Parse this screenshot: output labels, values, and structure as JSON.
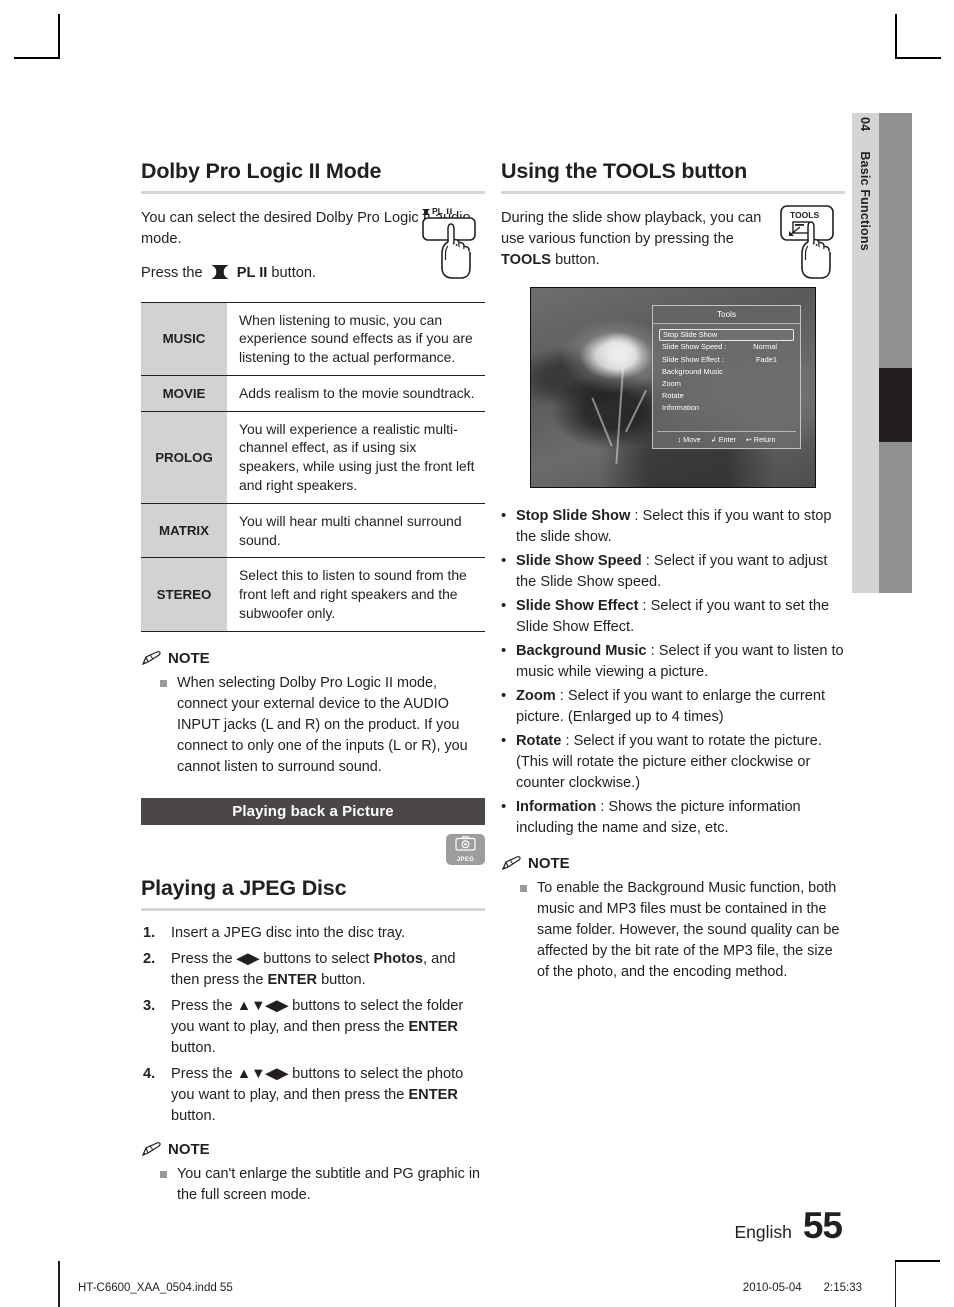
{
  "page": {
    "chapter_number": "04",
    "chapter_title": "Basic Functions",
    "language": "English",
    "page_number": "55",
    "footer_file": "HT-C6600_XAA_0504.indd   55",
    "footer_date": "2010-05-04",
    "footer_time": "2:15:33"
  },
  "left_column": {
    "heading": "Dolby Pro Logic II Mode",
    "intro_line1": "You can select the desired Dolby Pro",
    "intro_line2": "Logic II audio mode.",
    "press_prefix": "Press the",
    "press_button": "PL II",
    "press_suffix": "button.",
    "button_illustration_label": "PL II",
    "modes_table": {
      "rows": [
        {
          "name": "MUSIC",
          "desc": "When listening to music, you can experience sound effects as if you are listening to the actual performance."
        },
        {
          "name": "MOVIE",
          "desc": "Adds realism to the movie soundtrack."
        },
        {
          "name": "PROLOG",
          "desc": "You will experience a realistic multi-channel effect, as if using six speakers, while using just the front left and right speakers."
        },
        {
          "name": "MATRIX",
          "desc": "You will hear multi channel surround sound."
        },
        {
          "name": "STEREO",
          "desc": "Select this to listen to sound from the front left and right speakers and the subwoofer only."
        }
      ]
    },
    "note_label": "NOTE",
    "note_items": [
      "When selecting Dolby Pro Logic II mode, connect your external device to the AUDIO INPUT jacks (L and R) on the product. If you connect to only one of the inputs (L or R), you cannot listen to surround sound."
    ],
    "section_bar": "Playing back a Picture",
    "media_badge": "JPEG",
    "subheading": "Playing a JPEG Disc",
    "steps": [
      {
        "parts": [
          {
            "t": "Insert a JPEG disc into the disc tray.",
            "b": false
          }
        ]
      },
      {
        "parts": [
          {
            "t": "Press the ",
            "b": false
          },
          {
            "t": "◀▶",
            "b": true
          },
          {
            "t": " buttons to select ",
            "b": false
          },
          {
            "t": "Photos",
            "b": true
          },
          {
            "t": ", and then press the ",
            "b": false
          },
          {
            "t": "ENTER",
            "b": true
          },
          {
            "t": " button.",
            "b": false
          }
        ]
      },
      {
        "parts": [
          {
            "t": "Press the ",
            "b": false
          },
          {
            "t": "▲▼◀▶",
            "b": true
          },
          {
            "t": " buttons to select the folder you want to play, and then press the ",
            "b": false
          },
          {
            "t": "ENTER",
            "b": true
          },
          {
            "t": " button.",
            "b": false
          }
        ]
      },
      {
        "parts": [
          {
            "t": "Press the ",
            "b": false
          },
          {
            "t": "▲▼◀▶",
            "b": true
          },
          {
            "t": " buttons to select the photo you want to play, and then press the ",
            "b": false
          },
          {
            "t": "ENTER",
            "b": true
          },
          {
            "t": " button.",
            "b": false
          }
        ]
      }
    ],
    "note2_label": "NOTE",
    "note2_items": [
      "You can't enlarge the subtitle and PG graphic in the full screen mode."
    ]
  },
  "right_column": {
    "heading": "Using the TOOLS button",
    "intro_prefix": "During the slide show playback, you can use various function by pressing the ",
    "intro_button": "TOOLS",
    "intro_suffix": " button.",
    "button_illustration_label": "TOOLS",
    "screenshot": {
      "menu_title": "Tools",
      "items": [
        {
          "label": "Stop Slide Show",
          "value": "",
          "selected": true
        },
        {
          "label": "Slide Show Speed  :",
          "value": "Normal",
          "selected": false
        },
        {
          "label": "Slide Show Effect   :",
          "value": "Fade1",
          "selected": false
        },
        {
          "label": "Background Music",
          "value": "",
          "selected": false
        },
        {
          "label": "Zoom",
          "value": "",
          "selected": false
        },
        {
          "label": "Rotate",
          "value": "",
          "selected": false
        },
        {
          "label": "Information",
          "value": "",
          "selected": false
        }
      ],
      "footer": [
        {
          "icon": "↕",
          "label": "Move"
        },
        {
          "icon": "↲",
          "label": "Enter"
        },
        {
          "icon": "↩",
          "label": "Return"
        }
      ]
    },
    "tool_descriptions": [
      {
        "term": "Stop Slide Show",
        "desc": " : Select this if you want to stop the slide show."
      },
      {
        "term": "Slide Show Speed",
        "desc": " : Select if you want to adjust the Slide Show speed."
      },
      {
        "term": "Slide Show Effect",
        "desc": " : Select if you want to set the Slide Show Effect."
      },
      {
        "term": "Background Music",
        "desc": " : Select if you want to listen to music while viewing a picture."
      },
      {
        "term": "Zoom",
        "desc": " : Select if you want to enlarge the current picture. (Enlarged up to 4 times)"
      },
      {
        "term": "Rotate",
        "desc": " : Select if you want to rotate the picture. (This will rotate the picture either clockwise or counter clockwise.)"
      },
      {
        "term": "Information",
        "desc": " : Shows the picture information including the name and size, etc."
      }
    ],
    "note_label": "NOTE",
    "note_items": [
      "To enable the Background Music function, both music and MP3 files must be contained in the same folder. However, the sound quality can be affected by the bit rate of the MP3 file, the size of the photo, and the encoding method."
    ]
  }
}
